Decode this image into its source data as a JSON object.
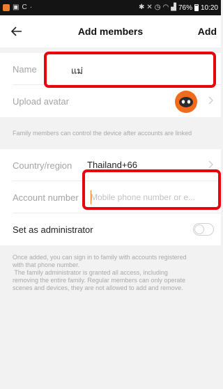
{
  "status_bar": {
    "battery": "76%",
    "time": "10:20"
  },
  "header": {
    "title": "Add members",
    "add_label": "Add"
  },
  "form": {
    "name_label": "Name",
    "name_value": "แม่",
    "upload_avatar_label": "Upload avatar",
    "family_hint": "Family members can control the device after accounts are linked",
    "country_label": "Country/region",
    "country_value": "Thailand+66",
    "account_label": "Account number",
    "account_placeholder": "Mobile phone number or e...",
    "admin_label": "Set as administrator",
    "admin_enabled": false
  },
  "footer_note": {
    "lines": [
      "Once added, you can sign in to family with accounts registered",
      "with that phone number.",
      " The family administrator is granted all access, including",
      "removing the entire family. Regular members can only operate",
      "scenes and devices, they are not allowed to add and remove."
    ]
  },
  "colors": {
    "accent": "#f07d2a",
    "highlight": "#e8050c",
    "background": "#f2f2f2"
  }
}
